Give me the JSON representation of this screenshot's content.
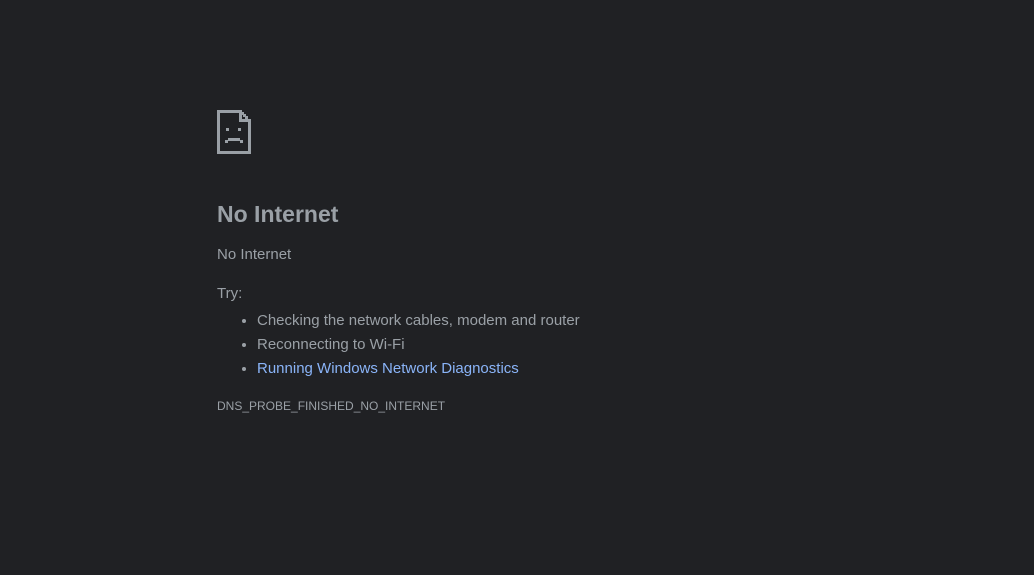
{
  "error_page": {
    "icon": "sad-document-icon",
    "title": "No Internet",
    "subtitle": "No Internet",
    "try_label": "Try:",
    "suggestions": [
      "Checking the network cables, modem and router",
      "Reconnecting to Wi-Fi"
    ],
    "diagnostics_link": "Running Windows Network Diagnostics",
    "error_code": "DNS_PROBE_FINISHED_NO_INTERNET"
  },
  "colors": {
    "background": "#202124",
    "text": "#9aa0a6",
    "link": "#8ab4f8"
  }
}
